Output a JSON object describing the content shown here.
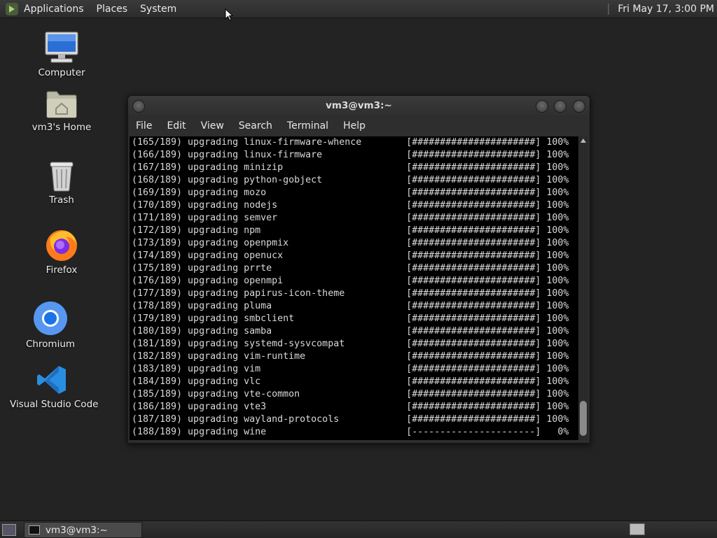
{
  "top_panel": {
    "menus": [
      "Applications",
      "Places",
      "System"
    ],
    "clock": "Fri May 17,  3:00 PM"
  },
  "desktop_icons": [
    {
      "label": "Computer",
      "icon": "computer-icon"
    },
    {
      "label": "vm3's Home",
      "icon": "home-folder-icon"
    },
    {
      "label": "Trash",
      "icon": "trash-icon"
    },
    {
      "label": "Firefox",
      "icon": "firefox-icon"
    },
    {
      "label": "Chromium",
      "icon": "chromium-icon"
    },
    {
      "label": "Visual Studio Code",
      "icon": "vscode-icon"
    }
  ],
  "terminal": {
    "title": "vm3@vm3:~",
    "menus": [
      "File",
      "Edit",
      "View",
      "Search",
      "Terminal",
      "Help"
    ],
    "lines": [
      "(165/189) upgrading linux-firmware-whence        [######################] 100%",
      "(166/189) upgrading linux-firmware               [######################] 100%",
      "(167/189) upgrading minizip                      [######################] 100%",
      "(168/189) upgrading python-gobject               [######################] 100%",
      "(169/189) upgrading mozo                         [######################] 100%",
      "(170/189) upgrading nodejs                       [######################] 100%",
      "(171/189) upgrading semver                       [######################] 100%",
      "(172/189) upgrading npm                          [######################] 100%",
      "(173/189) upgrading openpmix                     [######################] 100%",
      "(174/189) upgrading openucx                      [######################] 100%",
      "(175/189) upgrading prrte                        [######################] 100%",
      "(176/189) upgrading openmpi                      [######################] 100%",
      "(177/189) upgrading papirus-icon-theme           [######################] 100%",
      "(178/189) upgrading pluma                        [######################] 100%",
      "(179/189) upgrading smbclient                    [######################] 100%",
      "(180/189) upgrading samba                        [######################] 100%",
      "(181/189) upgrading systemd-sysvcompat           [######################] 100%",
      "(182/189) upgrading vim-runtime                  [######################] 100%",
      "(183/189) upgrading vim                          [######################] 100%",
      "(184/189) upgrading vlc                          [######################] 100%",
      "(185/189) upgrading vte-common                   [######################] 100%",
      "(186/189) upgrading vte3                         [######################] 100%",
      "(187/189) upgrading wayland-protocols            [######################] 100%",
      "(188/189) upgrading wine                         [----------------------]   0%"
    ]
  },
  "taskbar": {
    "task_label": "vm3@vm3:~"
  }
}
